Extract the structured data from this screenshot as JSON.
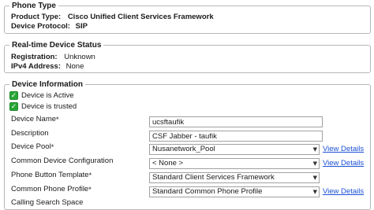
{
  "phone_type": {
    "title": "Phone Type",
    "product_type_label": "Product Type:",
    "product_type_value": "Cisco Unified Client Services Framework",
    "device_protocol_label": "Device Protocol:",
    "device_protocol_value": "SIP"
  },
  "realtime_status": {
    "title": "Real-time Device Status",
    "registration_label": "Registration:",
    "registration_value": "Unknown",
    "ipv4_label": "IPv4 Address:",
    "ipv4_value": "None"
  },
  "device_info": {
    "title": "Device Information",
    "status_active": "Device is Active",
    "status_trusted": "Device is trusted",
    "required_mark": "*",
    "view_details": "View Details",
    "device_name_label": "Device Name",
    "device_name_value": "ucsftaufik",
    "description_label": "Description",
    "description_value": "CSF Jabber - taufik",
    "device_pool_label": "Device Pool",
    "device_pool_value": "Nusanetwork_Pool",
    "common_device_config_label": "Common Device Configuration",
    "common_device_config_value": "< None >",
    "phone_button_template_label": "Phone Button Template",
    "phone_button_template_value": "Standard Client Services Framework",
    "common_phone_profile_label": "Common Phone Profile",
    "common_phone_profile_value": "Standard Common Phone Profile",
    "calling_search_space_label": "Calling Search Space"
  }
}
